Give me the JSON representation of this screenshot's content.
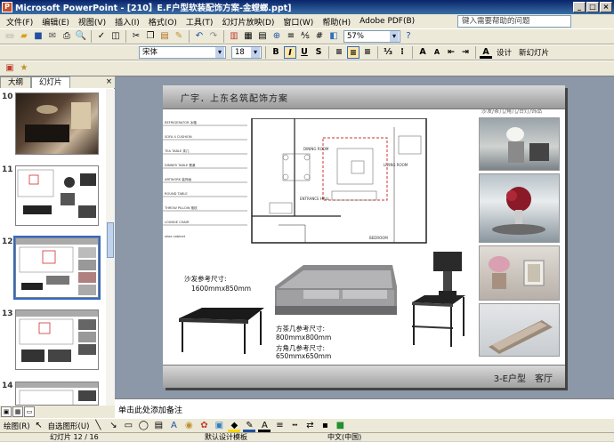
{
  "window": {
    "title": "Microsoft PowerPoint - [210】E.F户型软装配饰方案-金螳螂.ppt]",
    "icon": "P"
  },
  "menu": {
    "items": [
      "文件(F)",
      "编辑(E)",
      "视图(V)",
      "插入(I)",
      "格式(O)",
      "工具(T)",
      "幻灯片放映(D)",
      "窗口(W)",
      "帮助(H)",
      "Adobe PDF(B)"
    ],
    "help_placeholder": "键入需要帮助的问题"
  },
  "toolbar": {
    "zoom": "57%"
  },
  "format": {
    "font": "宋体",
    "size": "18",
    "bold": "B",
    "italic": "I",
    "underline": "U",
    "shadow": "S",
    "design_label": "设计",
    "newslide_label": "新幻灯片"
  },
  "left_pane": {
    "tabs": [
      "大纲",
      "幻灯片"
    ],
    "close": "×",
    "slides": [
      {
        "num": "10"
      },
      {
        "num": "11"
      },
      {
        "num": "12"
      },
      {
        "num": "13"
      },
      {
        "num": "14"
      }
    ]
  },
  "slide": {
    "title": "广宇．上东名筑配饰方案",
    "caption": "沙发/茶几/角几/台灯/饰品",
    "sofa_label": "沙发参考尺寸:",
    "sofa_size": "1600mmx850mm",
    "table_label_1": "方茶几参考尺寸:",
    "table_size_1": "800mmx800mm",
    "table_label_2": "方角几参考尺寸:",
    "table_size_2": "650mmx650mm",
    "footer": "3-E户型　客厅",
    "plan_labels": [
      "DINING ROOM",
      "LIVING ROOM",
      "ENTRANCE HALL",
      "BEDROOM"
    ],
    "spec_items": [
      "REFRIGERATOR 冰箱",
      "SOFA 4 CUSHION",
      "TEA TABLE 茶几",
      "DINNER TABLE 餐桌",
      "ARTWORK 装饰画",
      "ROUND TABLE",
      "THROW PILLOW 抱枕",
      "LOUNGE CHAIR",
      "shoe cabinet"
    ]
  },
  "notes": {
    "placeholder": "单击此处添加备注"
  },
  "drawbar": {
    "draw_label": "绘图(R)",
    "autoshape_label": "自选图形(U)"
  },
  "status": {
    "slide": "幻灯片 12 / 16",
    "design": "默认设计模板",
    "lang": "中文(中国)"
  }
}
